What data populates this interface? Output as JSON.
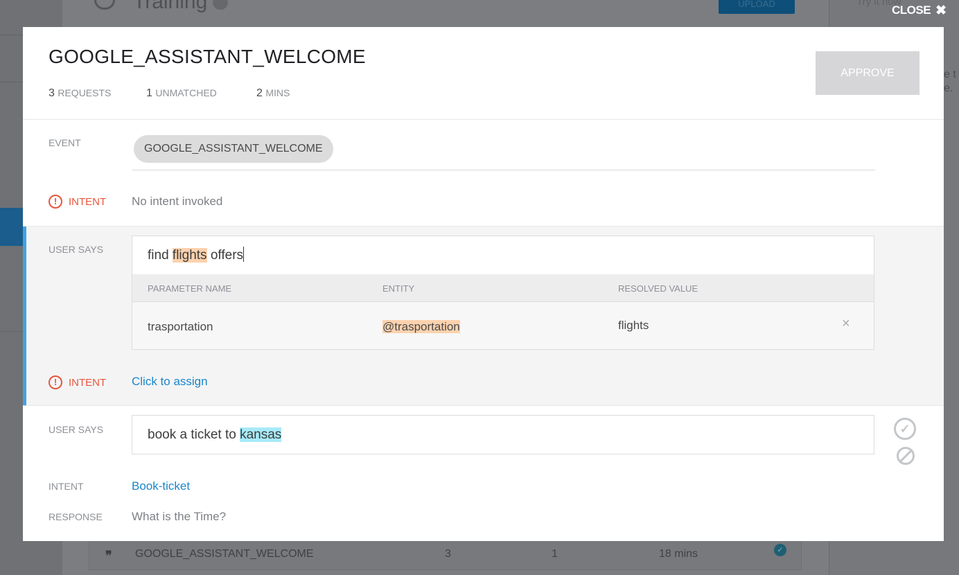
{
  "background": {
    "page_title": "Training",
    "upload_label": "UPLOAD",
    "try_it": "Try it now",
    "side_text": "e t\ne.",
    "row": {
      "name": "GOOGLE_ASSISTANT_WELCOME",
      "requests": "3",
      "unmatched": "1",
      "time": "18 mins"
    }
  },
  "close_label": "CLOSE",
  "modal": {
    "title": "GOOGLE_ASSISTANT_WELCOME",
    "stats": [
      {
        "value": "3",
        "label": "REQUESTS"
      },
      {
        "value": "1",
        "label": "UNMATCHED"
      },
      {
        "value": "2",
        "label": "MINS"
      }
    ],
    "approve_label": "APPROVE",
    "event": {
      "label": "EVENT",
      "chip": "GOOGLE_ASSISTANT_WELCOME"
    },
    "intent1": {
      "label": "INTENT",
      "value": "No intent invoked"
    },
    "user_says_1": {
      "label": "USER SAYS",
      "text_before": "find ",
      "highlight": "flights",
      "text_after": " offers"
    },
    "params": {
      "headers": [
        "PARAMETER NAME",
        "ENTITY",
        "RESOLVED VALUE"
      ],
      "row": {
        "name": "trasportation",
        "entity": "@trasportation",
        "value": "flights"
      },
      "remove_icon": "×"
    },
    "intent2": {
      "label": "INTENT",
      "value": "Click to assign"
    },
    "user_says_2": {
      "label": "USER SAYS",
      "text_before": "book a ticket to ",
      "highlight": "kansas"
    },
    "intent3": {
      "label": "INTENT",
      "value": "Book-ticket"
    },
    "response": {
      "label": "RESPONSE",
      "value": "What is the Time?"
    }
  }
}
